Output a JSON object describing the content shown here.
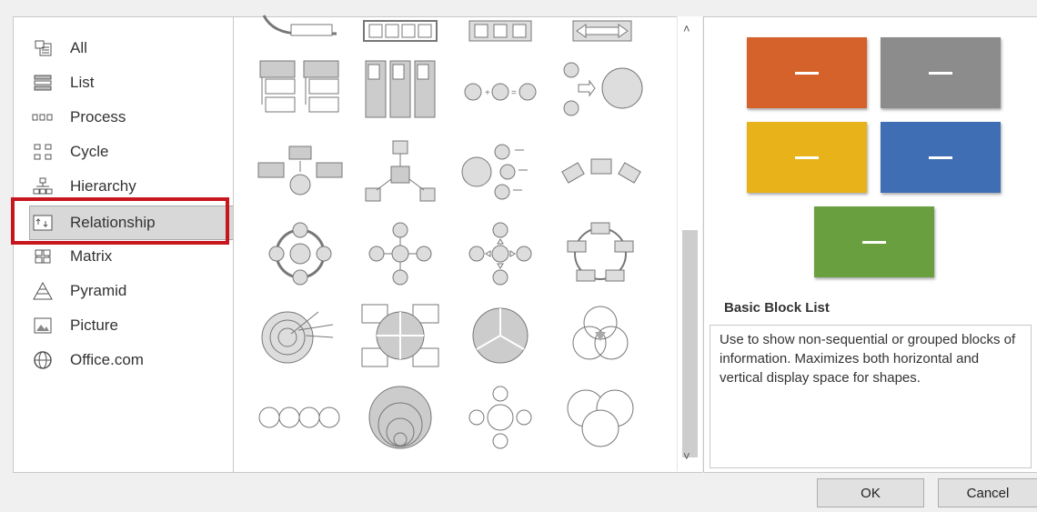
{
  "categories": [
    {
      "label": "All",
      "icon": "all-icon"
    },
    {
      "label": "List",
      "icon": "list-icon"
    },
    {
      "label": "Process",
      "icon": "process-icon"
    },
    {
      "label": "Cycle",
      "icon": "cycle-icon"
    },
    {
      "label": "Hierarchy",
      "icon": "hierarchy-icon"
    },
    {
      "label": "Relationship",
      "icon": "relationship-icon",
      "selected": true
    },
    {
      "label": "Matrix",
      "icon": "matrix-icon"
    },
    {
      "label": "Pyramid",
      "icon": "pyramid-icon"
    },
    {
      "label": "Picture",
      "icon": "picture-icon"
    },
    {
      "label": "Office.com",
      "icon": "globe-icon"
    }
  ],
  "preview": {
    "title": "Basic Block List",
    "description": "Use to show non-sequential or grouped blocks of information. Maximizes both horizontal and vertical display space for shapes.",
    "block_colors": [
      "#d5622a",
      "#8c8c8c",
      "#e8b21a",
      "#3f6eb5",
      "#6a9f3f"
    ]
  },
  "buttons": {
    "ok": "OK",
    "cancel": "Cancel"
  },
  "scroll": {
    "up": "˄",
    "down": "˅"
  }
}
